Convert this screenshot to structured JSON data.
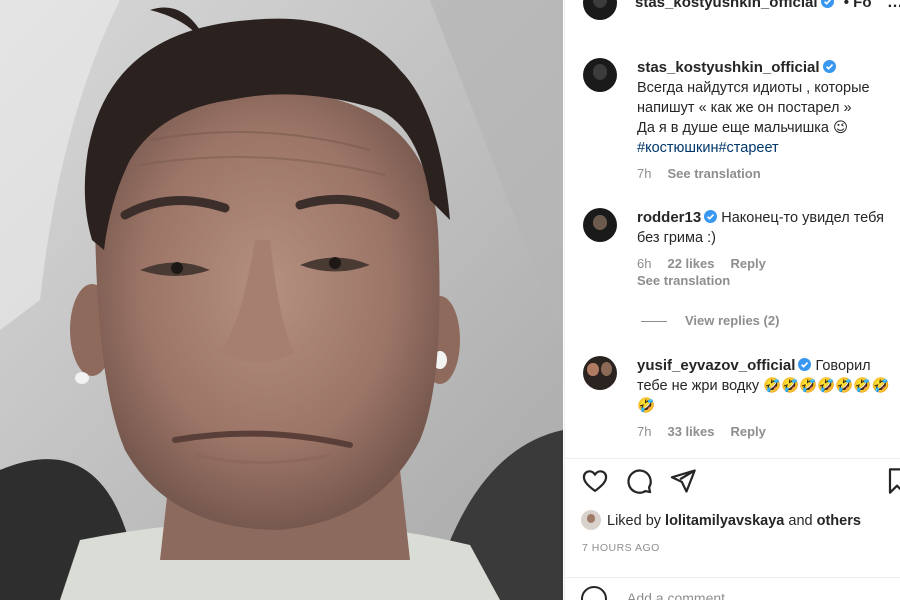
{
  "post": {
    "photo_alt": "selfie"
  },
  "header": {
    "username": "stas_kostyushkin_official",
    "follow_fragment": "• Fo",
    "more_label": "…"
  },
  "caption": {
    "username": "stas_kostyushkin_official",
    "lines": [
      "Всегда найдутся идиоты , которые",
      "напишут « как же он постарел »",
      "Да я в душе еще мальчишка 😉"
    ],
    "hashtags": "#костюшкин#стареет",
    "time": "7h",
    "see_translation": "See translation"
  },
  "comments": [
    {
      "username": "rodder13",
      "text": "Наконец-то увидел тебя без грима :)",
      "time": "6h",
      "likes": "22 likes",
      "reply": "Reply",
      "see_translation": "See translation",
      "view_replies": "View replies (2)"
    },
    {
      "username": "yusif_eyvazov_official",
      "text": "Говорил тебе не жри водку 🤣🤣🤣🤣🤣🤣🤣🤣",
      "time": "7h",
      "likes": "33 likes",
      "reply": "Reply"
    }
  ],
  "liked_by": {
    "prefix": "Liked by",
    "user": "lolitamilyavskaya",
    "and": "and",
    "others": "others"
  },
  "posted_ago": "7 HOURS AGO",
  "add_comment_placeholder": "Add a comment…",
  "colors": {
    "verified": "#3897f0",
    "hashtag": "#00376b",
    "muted": "#8e8e8e"
  }
}
